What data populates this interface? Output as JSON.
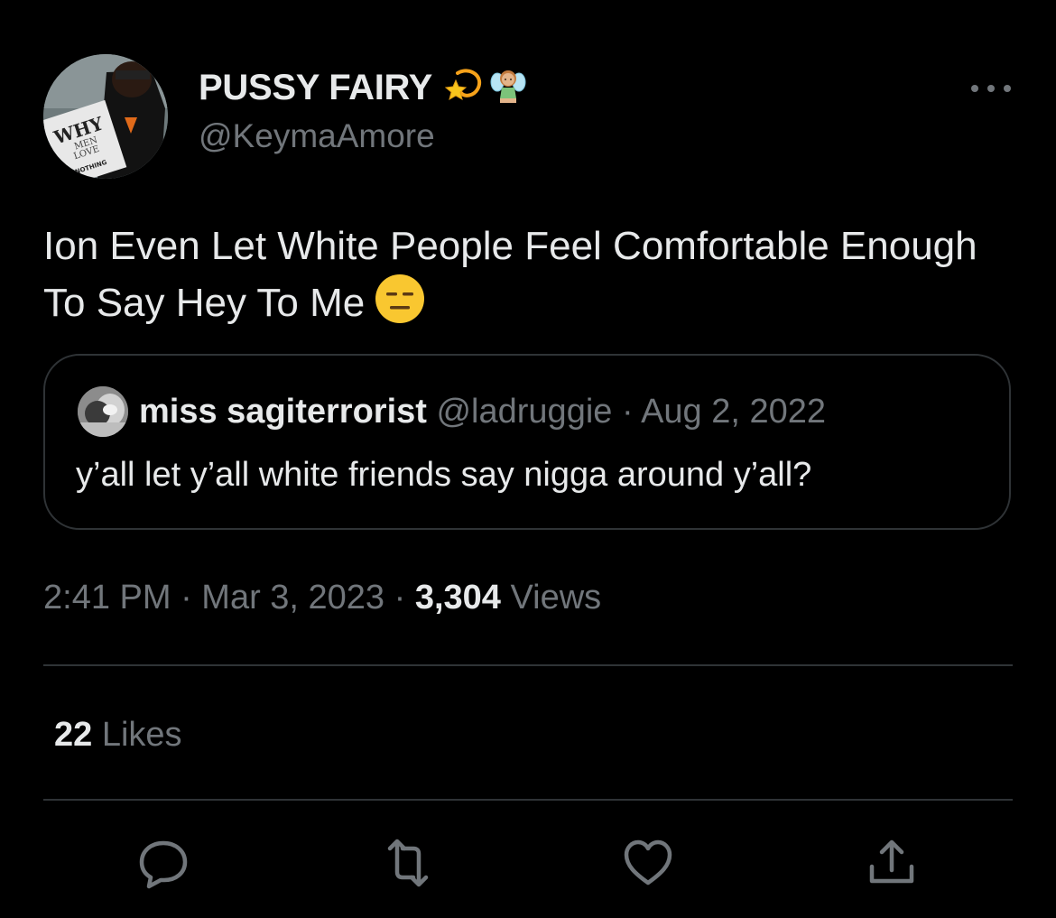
{
  "author": {
    "display_name": "PUSSY FAIRY",
    "handle": "@KeymaAmore",
    "name_emojis": [
      "dizzy-star-emoji",
      "fairy-emoji"
    ],
    "avatar_text": [
      "WHY",
      "MEN",
      "LOVE",
      "NOTHING"
    ]
  },
  "tweet": {
    "text": "Ion Even Let White People Feel Comfortable Enough To Say Hey To Me",
    "trailing_emoji": "expressionless-face-emoji"
  },
  "quoted_tweet": {
    "name": "miss sagiterrorist",
    "meta": "@ladruggie · Aug 2, 2022",
    "text": "y’all let y’all white friends say nigga around y’all?"
  },
  "timestamp": {
    "time_date": "2:41 PM · Mar 3, 2023 · ",
    "views_count": "3,304",
    "views_label": " Views"
  },
  "engagement": {
    "likes_count": "22",
    "likes_label": " Likes"
  },
  "actions": [
    "reply-icon",
    "retweet-icon",
    "like-icon",
    "share-icon"
  ],
  "colors": {
    "background": "#000000",
    "primary_text": "#e7e9ea",
    "secondary_text": "#71767b",
    "border": "#2f3336"
  }
}
